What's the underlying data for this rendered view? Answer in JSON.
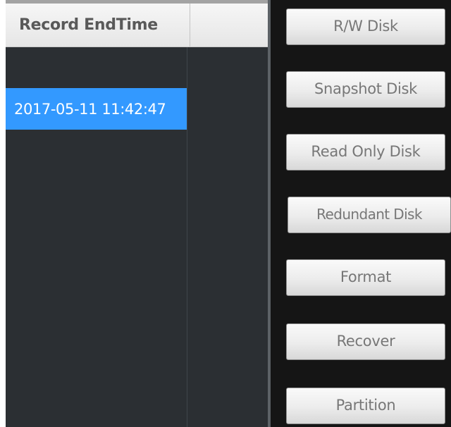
{
  "table": {
    "header": {
      "column_label": "Record EndTime"
    },
    "rows": [
      {
        "record_end_time": ""
      },
      {
        "record_end_time": "2017-05-11 11:42:47",
        "selected": true
      }
    ]
  },
  "buttons": {
    "rw_disk": "R/W Disk",
    "snapshot_disk": "Snapshot Disk",
    "read_only_disk": "Read Only Disk",
    "redundant_disk": "Redundant Disk",
    "format": "Format",
    "recover": "Recover",
    "partition": "Partition"
  },
  "colors": {
    "selection": "#3399ff",
    "table_background": "#2b2f33",
    "panel_background": "#151515"
  }
}
